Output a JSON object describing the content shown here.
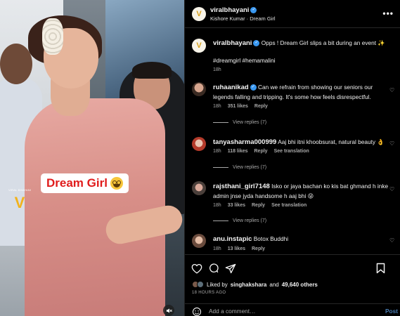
{
  "media": {
    "overlay_text": "Dream Girl",
    "overlay_emoji": "star-struck-emoji",
    "watermark": "VIRAL BHAYANI",
    "mute_icon": "speaker-muted-icon"
  },
  "header": {
    "username": "viralbhayani",
    "verified": true,
    "audio": "Kishore Kumar · Dream Girl",
    "more_icon": "more-horizontal-icon"
  },
  "caption": {
    "username": "viralbhayani",
    "text": "Opps ! Dream Girl slips a bit during an event ✨",
    "hashtags": "#dreamgirl #hemamalini",
    "time": "18h"
  },
  "comments": [
    {
      "username": "ruhaanikad",
      "verified": true,
      "text": "Can we refrain from showing our seniors our legends falling and tripping. It's some how feels disrespectful.",
      "time": "18h",
      "likes": "351 likes",
      "reply_label": "Reply",
      "translate_label": "",
      "view_replies": "View replies (7)"
    },
    {
      "username": "tanyasharma000999",
      "verified": false,
      "text": "Aaj bhi itni khoobsurat, natural beauty 👌",
      "time": "18h",
      "likes": "118 likes",
      "reply_label": "Reply",
      "translate_label": "See translation",
      "view_replies": "View replies (7)"
    },
    {
      "username": "rajsthani_girl7148",
      "verified": false,
      "text": "Isko or jaya bachan ko kis bat ghmand h inke admin jnse jyda handsome h aaj bhi 😝",
      "time": "18h",
      "likes": "33 likes",
      "reply_label": "Reply",
      "translate_label": "See translation",
      "view_replies": "View replies (7)"
    },
    {
      "username": "anu.instapic",
      "verified": false,
      "text": "Botox Buddhi",
      "time": "18h",
      "likes": "13 likes",
      "reply_label": "Reply",
      "translate_label": "",
      "view_replies": ""
    }
  ],
  "actions": {
    "icons": [
      "heart-icon",
      "comment-icon",
      "share-icon",
      "save-icon"
    ],
    "liked_by_prefix": "Liked by",
    "liked_by_user": "singhakshara",
    "liked_by_joiner": "and",
    "liked_by_count": "49,640 others",
    "posted_ago": "18 HOURS AGO"
  },
  "add_comment": {
    "placeholder": "Add a comment…",
    "post_label": "Post"
  },
  "colors": {
    "accent_link": "#4a7db3",
    "verified_blue": "#3897f0",
    "overlay_red": "#e01c1c"
  }
}
